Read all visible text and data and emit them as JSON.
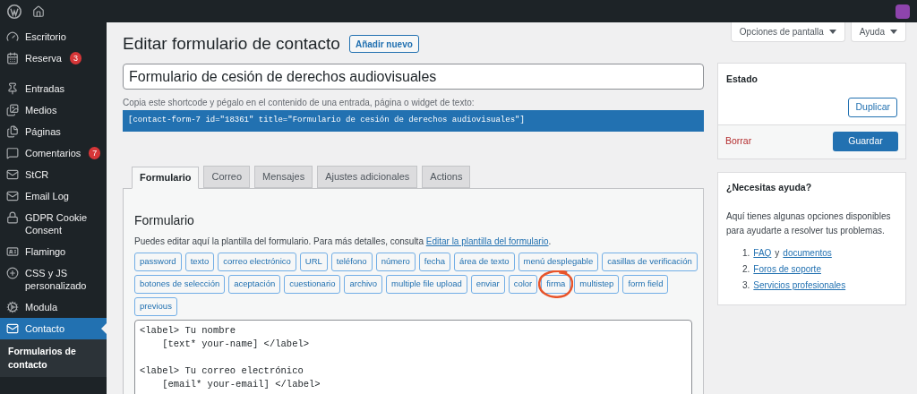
{
  "sidebar": {
    "items": [
      {
        "label": "Escritorio",
        "selected": false
      },
      {
        "label": "Reserva",
        "badge": "3",
        "selected": false
      },
      {
        "label": "Entradas",
        "selected": false
      },
      {
        "label": "Medios",
        "selected": false
      },
      {
        "label": "Páginas",
        "selected": false
      },
      {
        "label": "Comentarios",
        "badge": "7",
        "selected": false
      },
      {
        "label": "StCR",
        "selected": false
      },
      {
        "label": "Email Log",
        "selected": false
      },
      {
        "label": "GDPR Cookie Consent",
        "selected": false
      },
      {
        "label": "Flamingo",
        "selected": false
      },
      {
        "label": "CSS y JS personalizado",
        "selected": false
      },
      {
        "label": "Modula",
        "selected": false
      },
      {
        "label": "Contacto",
        "selected": true
      }
    ],
    "submenu": [
      {
        "label": "Formularios de contacto",
        "selected": true
      }
    ]
  },
  "screen_options": [
    "Opciones de pantalla",
    "Ayuda"
  ],
  "page": {
    "title": "Editar formulario de contacto",
    "add_new": "Añadir nuevo",
    "form_title": "Formulario de cesión de derechos audiovisuales",
    "shortcode_hint": "Copia este shortcode y pégalo en el contenido de una entrada, página o widget de texto:",
    "shortcode": "[contact-form-7 id=\"18361\" title=\"Formulario de cesión de derechos audiovisuales\"]"
  },
  "tabs": [
    {
      "label": "Formulario",
      "selected": true
    },
    {
      "label": "Correo",
      "selected": false
    },
    {
      "label": "Mensajes",
      "selected": false
    },
    {
      "label": "Ajustes adicionales",
      "selected": false
    },
    {
      "label": "Actions",
      "selected": false
    }
  ],
  "form_panel": {
    "heading": "Formulario",
    "description": "Puedes editar aquí la plantilla del formulario. Para más detalles, consulta ",
    "link": "Editar la plantilla del formulario",
    "after_link": ".",
    "tag_rows": [
      [
        "password",
        "texto",
        "correo electrónico",
        "URL",
        "teléfono",
        "número",
        "fecha",
        "área de texto",
        "menú desplegable",
        "casillas de verificación"
      ],
      [
        "botones de selección",
        "aceptación",
        "cuestionario",
        "archivo",
        "multiple file upload",
        "enviar",
        "color",
        "firma",
        "multistep",
        "form field"
      ],
      [
        "previous"
      ]
    ],
    "code_blocks": [
      [
        "<label> Tu nombre",
        "    [text* your-name] </label>"
      ],
      [
        "<label> Tu correo electrónico",
        "    [email* your-email] </label>"
      ]
    ]
  },
  "status_box": {
    "title": "Estado",
    "duplicate": "Duplicar",
    "delete": "Borrar",
    "save": "Guardar"
  },
  "help_box": {
    "title": "¿Necesitas ayuda?",
    "text": "Aquí tienes algunas opciones disponibles para ayudarte a resolver tus problemas.",
    "links": [
      {
        "number": "1.",
        "parts": [
          "FAQ",
          "documentos"
        ],
        "joiner": "y"
      },
      {
        "number": "2.",
        "parts": [
          "Foros de soporte"
        ]
      },
      {
        "number": "3.",
        "parts": [
          "Servicios profesionales"
        ]
      }
    ]
  }
}
